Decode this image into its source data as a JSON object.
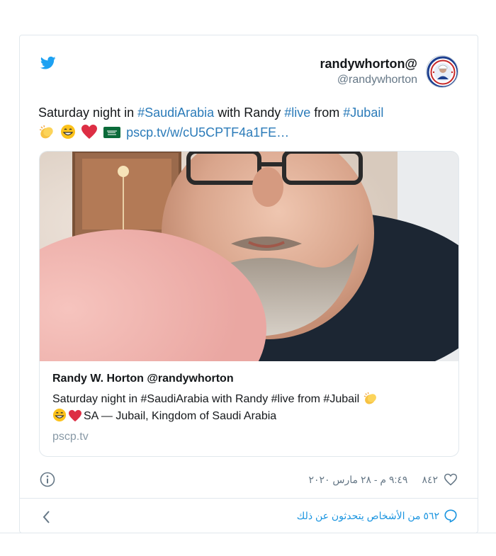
{
  "author": {
    "display_name": "randywhorton@",
    "handle": "@randywhorton"
  },
  "tweet": {
    "text_1": "Saturday night in ",
    "hashtag_1": "#SaudiArabia",
    "text_2": " with Randy ",
    "hashtag_2": "#live",
    "text_3": " from ",
    "hashtag_3": "#Jubail",
    "link": "pscp.tv/w/cU5CPTF4a1FE…",
    "emojis": [
      "clapping-hands-emoji",
      "grinning-face-emoji",
      "red-heart-emoji",
      "saudi-flag-emoji"
    ]
  },
  "card": {
    "author_line": "Randy W. Horton @randywhorton",
    "desc_1": "Saturday night in #SaudiArabia with Randy #live from #Jubail ",
    "desc_2": "SA — Jubail, Kingdom of Saudi Arabia",
    "domain": "pscp.tv"
  },
  "meta": {
    "like_count": "٨٤٢",
    "timestamp": "٩:٤٩ م - ٢٨ مارس ٢٠٢٠"
  },
  "footer": {
    "reply_text": "٥٦٢ من الأشخاص يتحدثون عن ذلك"
  },
  "colors": {
    "link": "#2b7bb9",
    "twitter_blue": "#1da1f2",
    "secondary_text": "#657786",
    "border": "#e1e8ed"
  }
}
